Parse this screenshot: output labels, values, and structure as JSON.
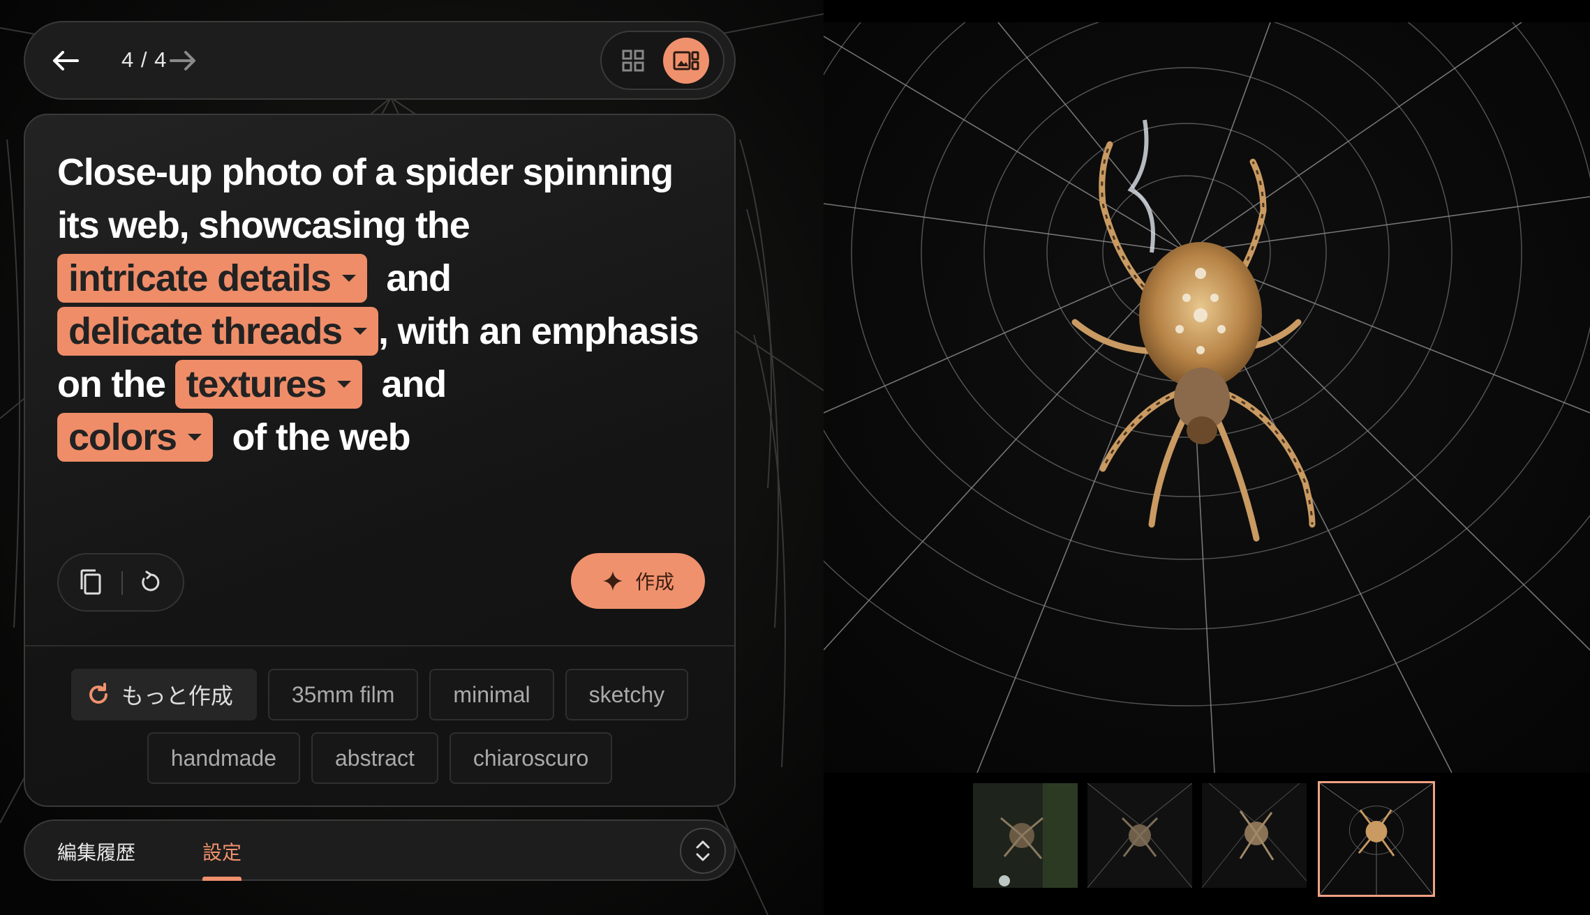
{
  "nav": {
    "counter": "4 / 4"
  },
  "prompt": {
    "part1": "Close-up photo of a spider spinning its web, showcasing the ",
    "chip1": "intricate details",
    "part2": "  and ",
    "chip2": "delicate threads",
    "part3": ", with an emphasis on the ",
    "chip3": "textures",
    "part4": "  and ",
    "chip4": "colors",
    "part5": "  of the web"
  },
  "actions": {
    "create_label": "作成"
  },
  "suggestions": {
    "more_label": "もっと作成",
    "styles": [
      "35mm film",
      "minimal",
      "sketchy",
      "handmade",
      "abstract",
      "chiaroscuro"
    ]
  },
  "tabs": {
    "history": "編集履歴",
    "settings": "設定"
  },
  "colors": {
    "accent": "#f0916d",
    "panel": "#1d1d1d",
    "background": "#000000"
  },
  "icons": [
    "back-arrow-icon",
    "forward-arrow-icon",
    "grid-view-icon",
    "single-view-icon",
    "copy-icon",
    "reset-icon",
    "sparkle-icon",
    "refresh-icon",
    "expand-icon"
  ]
}
